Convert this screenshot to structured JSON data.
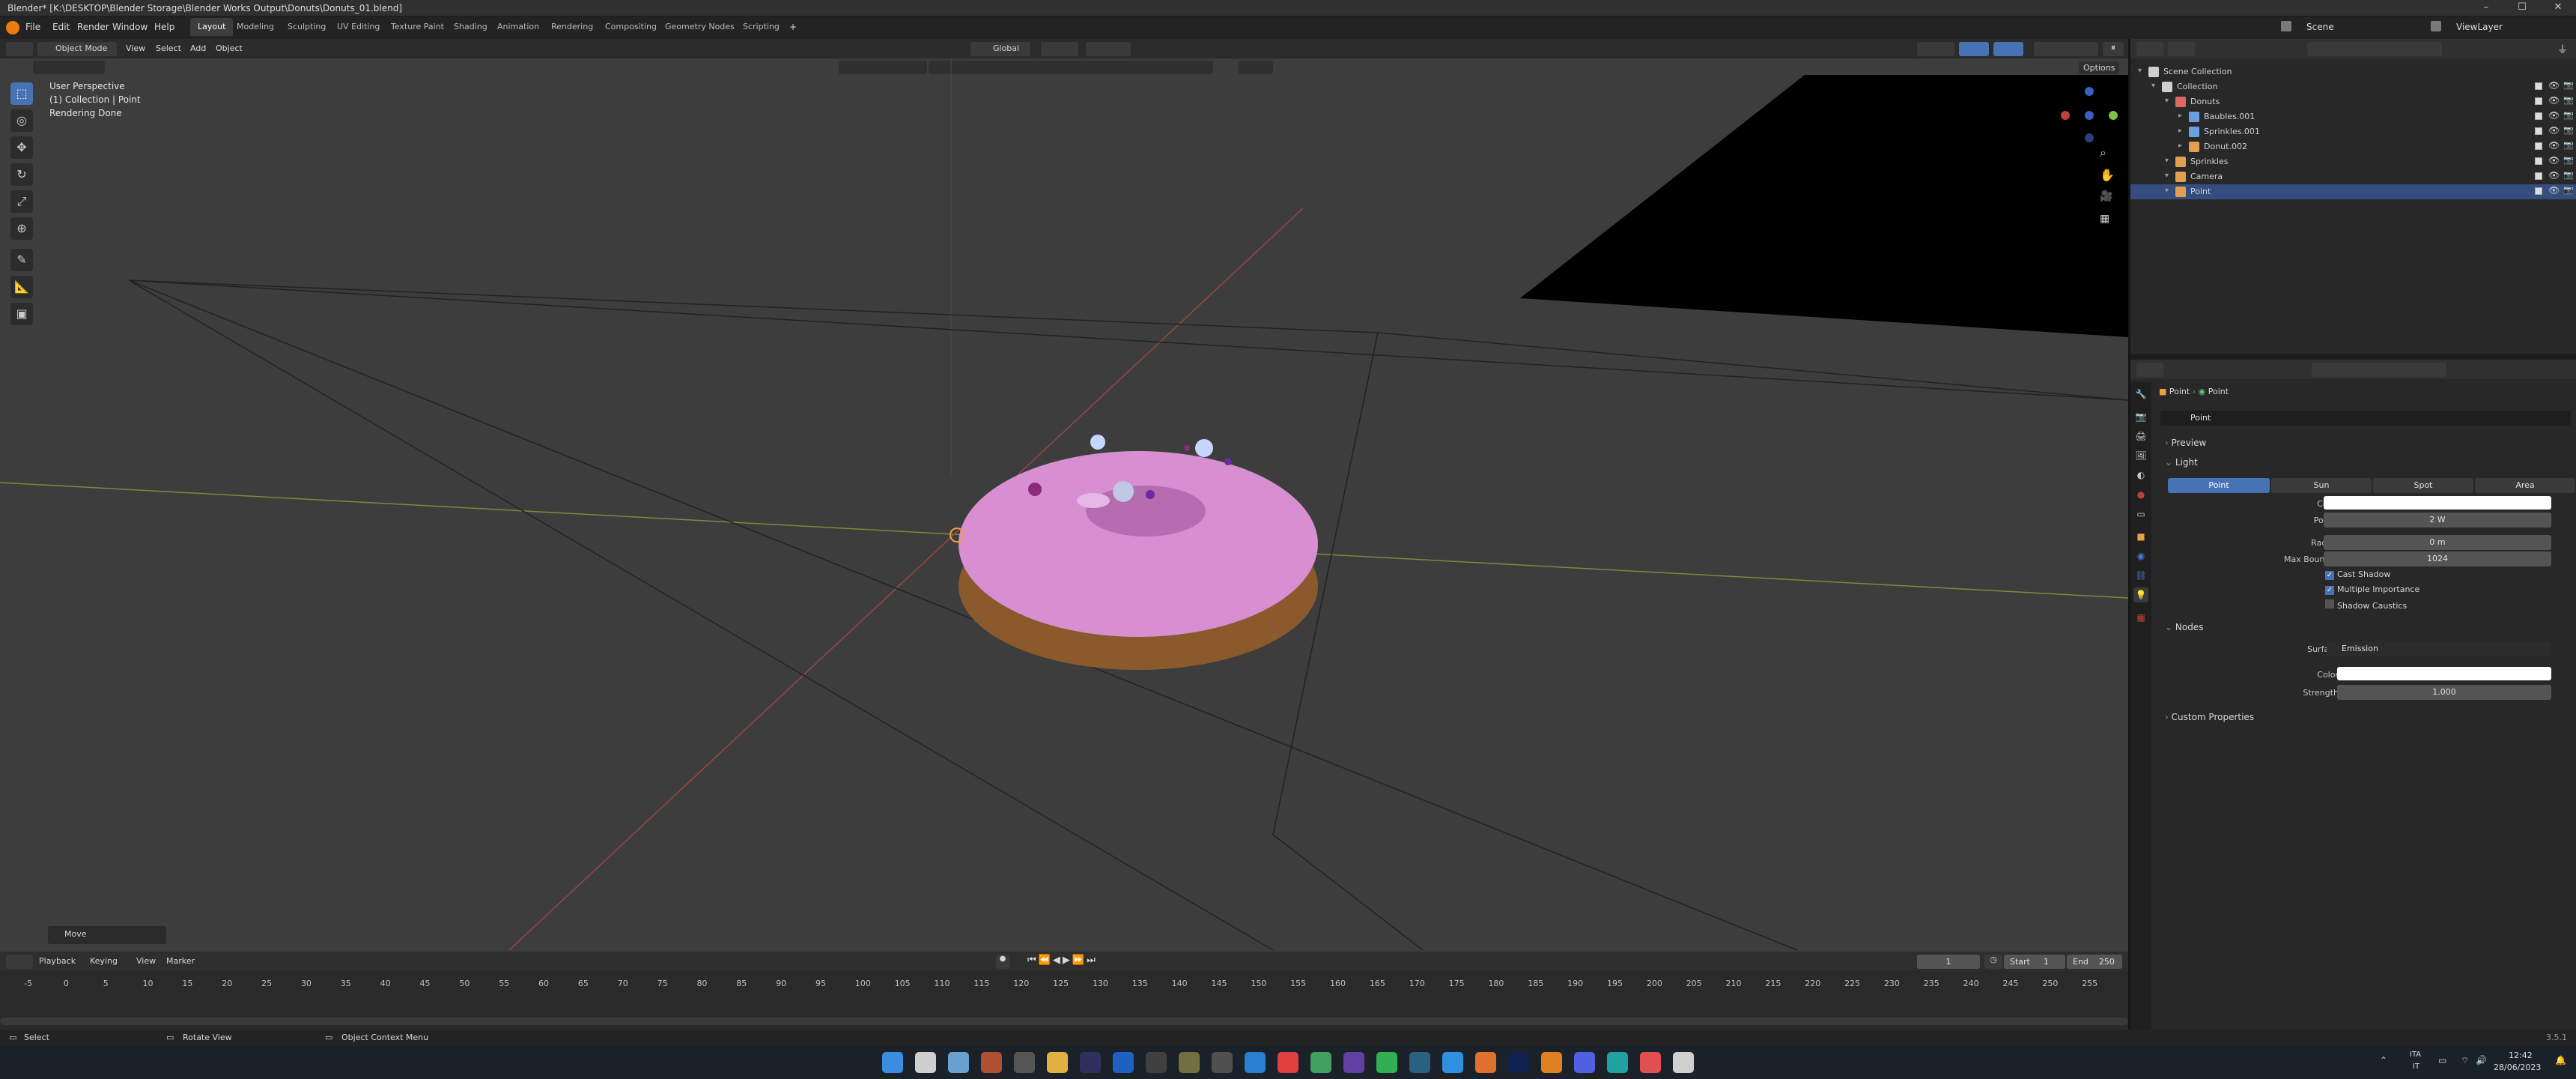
{
  "titlebar": {
    "title": "Blender* [K:\\DESKTOP\\Blender Storage\\Blender Works Output\\Donuts\\Donuts_01.blend]",
    "minimize": "–",
    "maximize": "☐",
    "close": "✕"
  },
  "menu": {
    "items": [
      "File",
      "Edit",
      "Render",
      "Window",
      "Help"
    ],
    "workspaces": [
      "Layout",
      "Modeling",
      "Sculpting",
      "UV Editing",
      "Texture Paint",
      "Shading",
      "Animation",
      "Rendering",
      "Compositing",
      "Geometry Nodes",
      "Scripting"
    ],
    "add_workspace": "+",
    "scene": "Scene",
    "viewlayer": "ViewLayer"
  },
  "viewport_header": {
    "mode": "Object Mode",
    "menus": [
      "View",
      "Select",
      "Add",
      "Object"
    ],
    "orientation": "Global",
    "options": "Options"
  },
  "viewport": {
    "perspective": "User Perspective",
    "collection": "(1) Collection | Point",
    "status": "Rendering Done",
    "last_op": "Move"
  },
  "outliner": {
    "rows": [
      {
        "label": "Scene Collection",
        "depth": 0,
        "color": "#cfcfcf"
      },
      {
        "label": "Collection",
        "depth": 1,
        "color": "#cfcfcf"
      },
      {
        "label": "Donuts",
        "depth": 2,
        "color": "#e06666"
      },
      {
        "label": "Baubles.001",
        "depth": 3,
        "color": "#6aa0e0"
      },
      {
        "label": "Sprinkles.001",
        "depth": 3,
        "color": "#6aa0e0"
      },
      {
        "label": "Donut.002",
        "depth": 3,
        "color": "#e0a050"
      },
      {
        "label": "Sprinkles",
        "depth": 2,
        "color": "#e0a050"
      },
      {
        "label": "Camera",
        "depth": 2,
        "color": "#e0a050"
      },
      {
        "label": "Point",
        "depth": 2,
        "color": "#e0a050",
        "selected": true
      }
    ]
  },
  "properties": {
    "breadcrumb": [
      "Point",
      "Point"
    ],
    "datablock": "Point",
    "panels": {
      "preview": "Preview",
      "light": "Light",
      "nodes": "Nodes",
      "custom": "Custom Properties"
    },
    "light_types": [
      "Point",
      "Sun",
      "Spot",
      "Area"
    ],
    "fields": {
      "color_label": "Color",
      "power_label": "Power",
      "power": "2 W",
      "radius_label": "Radius",
      "radius": "0 m",
      "bounces_label": "Max Bounces",
      "bounces": "1024",
      "cast_shadow": "Cast Shadow",
      "multiple_importance": "Multiple Importance",
      "shadow_caustics": "Shadow Caustics",
      "surface_label": "Surface",
      "surface": "Emission",
      "ncolor_label": "Color",
      "strength_label": "Strength",
      "strength": "1.000"
    }
  },
  "timeline": {
    "menus": [
      "Playback",
      "Keying",
      "View",
      "Marker"
    ],
    "current_frame": "1",
    "start_label": "Start",
    "start": "1",
    "end_label": "End",
    "end": "250",
    "ticks": [
      "-5",
      "0",
      "5",
      "10",
      "15",
      "20",
      "25",
      "30",
      "35",
      "40",
      "45",
      "50",
      "55",
      "60",
      "65",
      "70",
      "75",
      "80",
      "85",
      "90",
      "95",
      "100",
      "105",
      "110",
      "115",
      "120",
      "125",
      "130",
      "135",
      "140",
      "145",
      "150",
      "155",
      "160",
      "165",
      "170",
      "175",
      "180",
      "185",
      "190",
      "195",
      "200",
      "205",
      "210",
      "215",
      "220",
      "225",
      "230",
      "235",
      "240",
      "245",
      "250",
      "255"
    ],
    "playhead": "1"
  },
  "statusbar": {
    "select": "Select",
    "rotate": "Rotate View",
    "context": "Object Context Menu",
    "version": "3.5.1"
  },
  "taskbar": {
    "lang": "ITA",
    "lang2": "IT",
    "time": "12:42",
    "date": "28/06/2023"
  },
  "colors": {
    "accent": "#4772b3",
    "donut_icing": "#d98fd0",
    "donut_base": "#9a6b35"
  }
}
